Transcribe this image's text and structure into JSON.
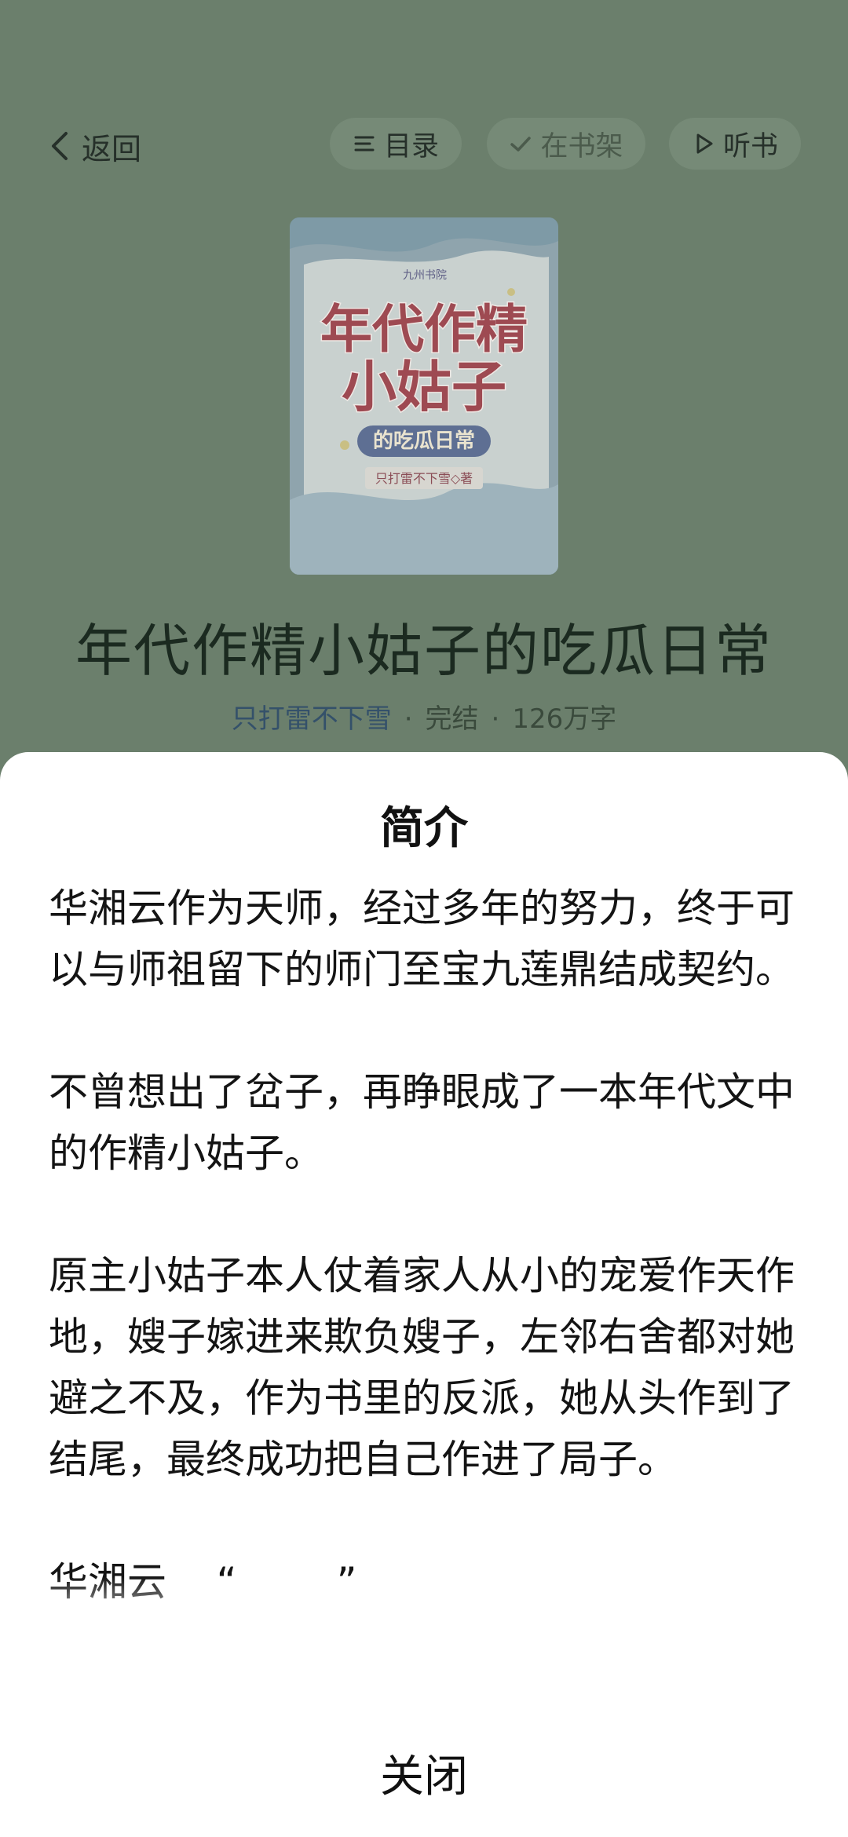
{
  "topbar": {
    "back_label": "返回",
    "toc_label": "目录",
    "shelf_label": "在书架",
    "listen_label": "听书"
  },
  "cover": {
    "publisher": "九州书院",
    "title_line1": "年代作精",
    "title_line2": "小姑子",
    "subtitle": "的吃瓜日常",
    "author_tag": "只打雷不下雪◇著"
  },
  "book": {
    "title": "年代作精小姑子的吃瓜日常",
    "author": "只打雷不下雪",
    "status": "完结",
    "word_count": "126万字"
  },
  "sheet": {
    "title": "简介",
    "paragraphs": [
      "华湘云作为天师，经过多年的努力，终于可以与师祖留下的师门至宝九莲鼎结成契约。",
      "不曾想出了岔子，再睁眼成了一本年代文中的作精小姑子。",
      "原主小姑子本人仗着家人从小的宠爱作天作地，嫂子嫁进来欺负嫂子，左邻右舍都对她避之不及，作为书里的反派，她从头作到了结尾，最终成功把自己作进了局子。",
      "华湘云    “        ”"
    ],
    "close_label": "关闭"
  },
  "colors": {
    "overlay_background": "#6b7f6c",
    "author_link": "#34516a",
    "sheet_background": "#ffffff"
  }
}
